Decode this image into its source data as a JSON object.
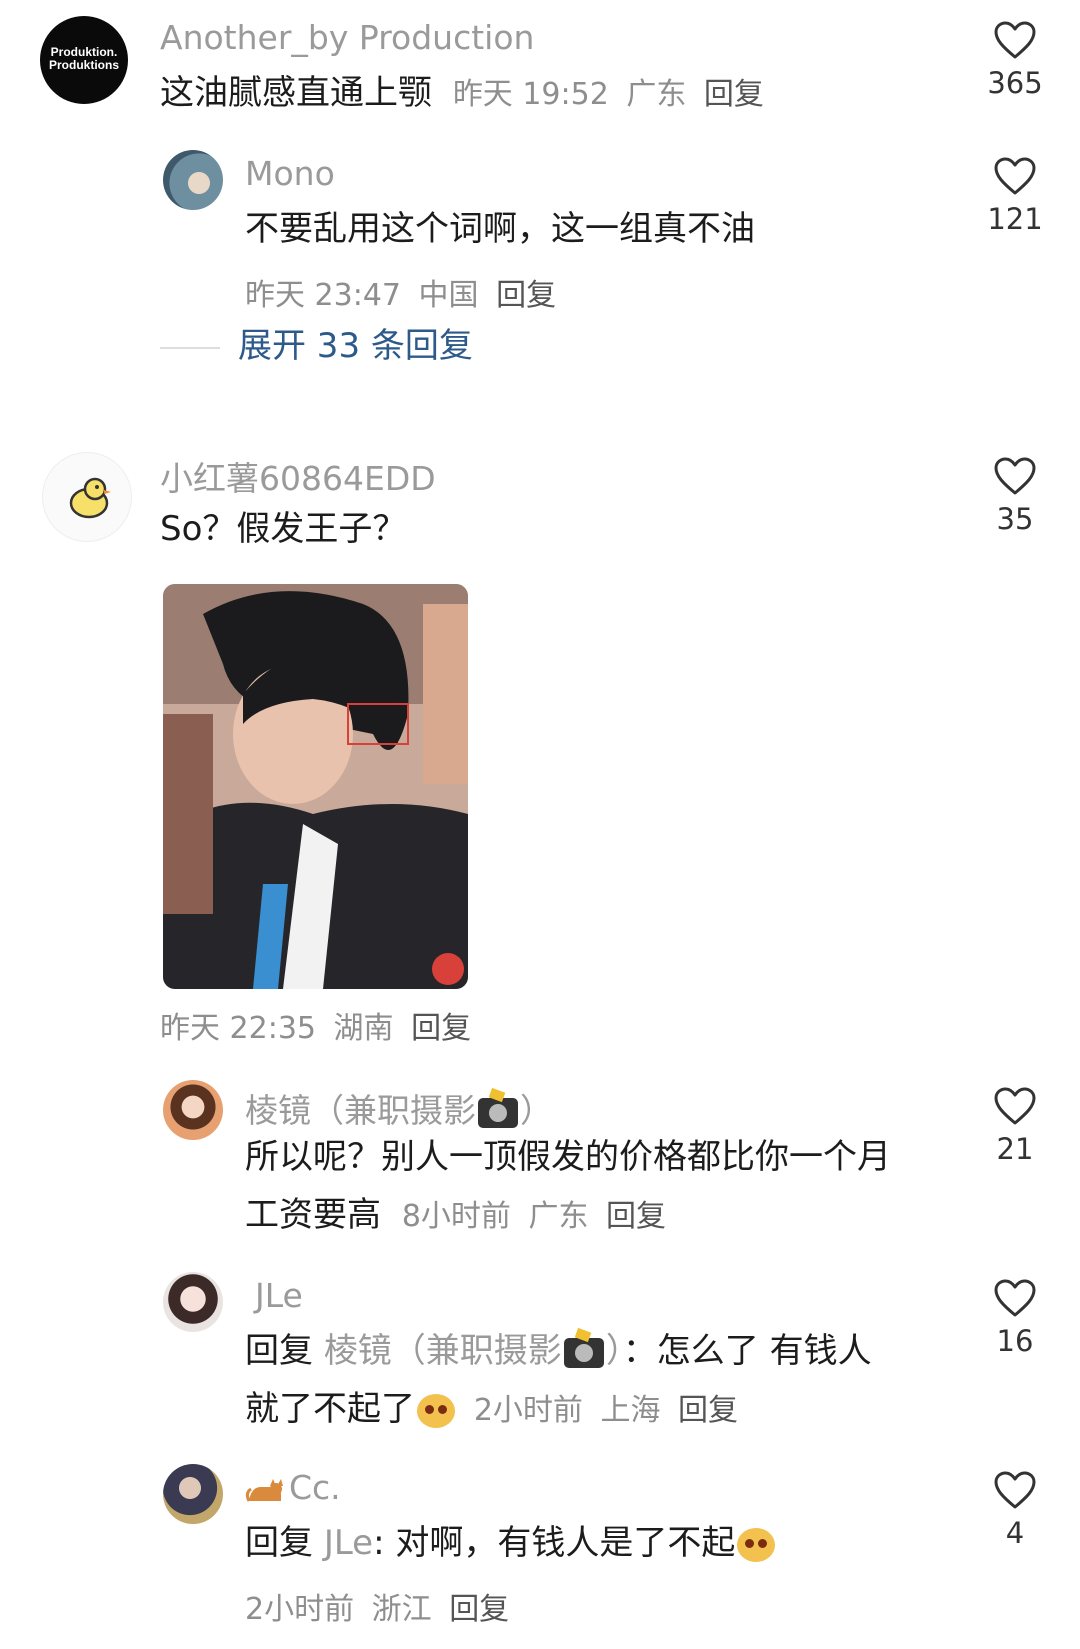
{
  "comments": [
    {
      "user": "Another_by Production",
      "avatar_text": [
        "Produktion.",
        "Produktions"
      ],
      "text": "这油腻感直通上颚",
      "time": "昨天 19:52",
      "location": "广东",
      "reply": "回复",
      "likes": "365"
    },
    {
      "user": "Mono",
      "text": "不要乱用这个词啊，这一组真不油",
      "time": "昨天 23:47",
      "location": "中国",
      "reply": "回复",
      "likes": "121"
    },
    {
      "user": "小红薯60864EDD",
      "text": "So？假发王子？",
      "time": "昨天 22:35",
      "location": "湖南",
      "reply": "回复",
      "likes": "35"
    },
    {
      "user": "棱镜（兼职摄影",
      "user_suffix": "）",
      "text_line1": "所以呢？别人一顶假发的价格都比你一个月",
      "text_line2": "工资要高",
      "time": "8小时前",
      "location": "广东",
      "reply": "回复",
      "likes": "21"
    },
    {
      "user": "JLe",
      "reply_prefix": "回复",
      "mention": "棱镜（兼职摄影",
      "mention_suffix": "）",
      "text_line1": "：怎么了 有钱人",
      "text_line2": "就了不起了",
      "time": "2小时前",
      "location": "上海",
      "reply": "回复",
      "likes": "16"
    },
    {
      "user": "Cc.",
      "reply_prefix": "回复",
      "mention": "JLe",
      "text": ": 对啊，有钱人是了不起",
      "time": "2小时前",
      "location": "浙江",
      "reply": "回复",
      "likes": "4"
    }
  ],
  "expand_replies": "展开 33 条回复",
  "colors": {
    "username": "#9a9a9a",
    "meta": "#8e8e8e",
    "link": "#2d5a8a",
    "text": "#1c1c1c"
  },
  "icons": [
    "heart-outline-icon",
    "chick-icon",
    "camera-flash-icon",
    "cat-icon",
    "emoji-face-icon"
  ]
}
